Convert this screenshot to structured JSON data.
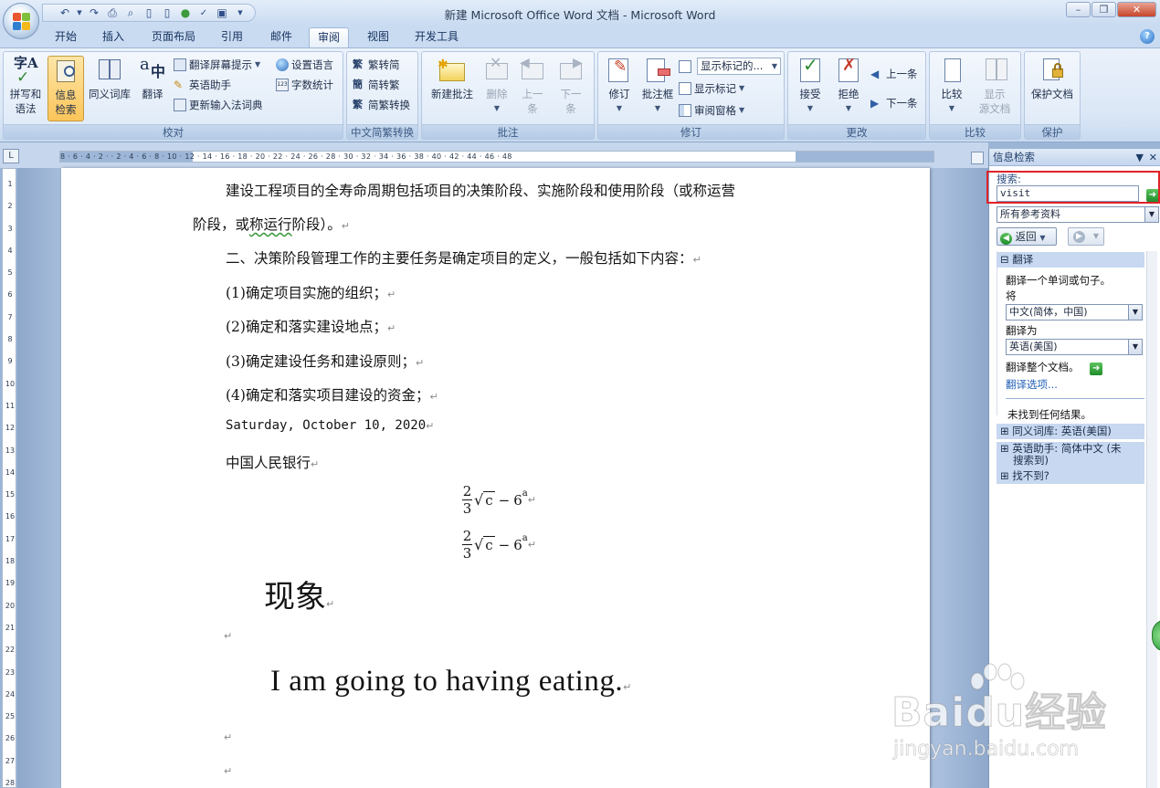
{
  "window": {
    "title": "新建 Microsoft Office Word 文档 - Microsoft Word"
  },
  "tabs": [
    "开始",
    "插入",
    "页面布局",
    "引用",
    "邮件",
    "审阅",
    "视图",
    "开发工具"
  ],
  "active_tab": "审阅",
  "ribbon": {
    "proofing": {
      "label": "校对",
      "spelling": "拼写和\n语法",
      "research": "信息\n检索",
      "thesaurus": "同义词库",
      "translate": "翻译",
      "translate_tip": "翻译屏幕提示",
      "english_assistant": "英语助手",
      "update_ime": "更新输入法词典",
      "set_language": "设置语言",
      "word_count": "字数统计"
    },
    "chinese_conversion": {
      "label": "中文简繁转换",
      "t2s": "繁转简",
      "s2t": "简转繁",
      "convert": "简繁转换"
    },
    "comments": {
      "label": "批注",
      "new": "新建批注",
      "delete": "删除",
      "prev": "上一\n条",
      "next": "下一\n条"
    },
    "tracking": {
      "label": "修订",
      "track": "修订",
      "balloons": "批注框",
      "display_combo": "显示标记的...",
      "show_markup": "显示标记",
      "review_pane": "审阅窗格"
    },
    "changes": {
      "label": "更改",
      "accept": "接受",
      "reject": "拒绝",
      "previous": "上一条",
      "next": "下一条"
    },
    "compare": {
      "label": "比较",
      "compare": "比较",
      "show_source": "显示\n源文档"
    },
    "protect": {
      "label": "保护",
      "protect_doc": "保护文档"
    }
  },
  "ruler": {
    "corner": "L",
    "h_numbers": "8 · 6 · 4 · 2 · · 2 · 4 · 6 · 8 · 10 · 12 · 14 · 16 · 18 · 20 · 22 · 24 · 26 · 28 · 30 · 32 · 34 · 36 · 38 · 40 · 42 · 44 · 46 · 48",
    "v_numbers": [
      "1",
      "2",
      "3",
      "4",
      "5",
      "6",
      "7",
      "8",
      "9",
      "10",
      "11",
      "12",
      "13",
      "14",
      "15",
      "16",
      "17",
      "18",
      "19",
      "20",
      "21",
      "22",
      "23",
      "24",
      "25",
      "26",
      "27",
      "28"
    ]
  },
  "document": {
    "p1_line1": "建设工程项目的全寿命周期包括项目的决策阶段、实施阶段和使用阶段（或称运营",
    "p1_line2_a": "阶段，或",
    "p1_line2_b": "称运行",
    "p1_line2_c": "阶段）。",
    "p2": "二、决策阶段管理工作的主要任务是确定项目的定义，一般包括如下内容：",
    "item1": "(1)确定项目实施的组织；",
    "item2": "(2)确定和落实建设地点；",
    "item3": "(3)确定建设任务和建设原则；",
    "item4": "(4)确定和落实项目建设的资金；",
    "date": "Saturday, October 10, 2020",
    "bank": "中国人民银行",
    "eq_num": "2",
    "eq_den": "3",
    "eq_rad": "c",
    "eq_minus": "−",
    "eq_base": "6",
    "eq_exp": "a",
    "big_cn": "现象",
    "big_en": "I am going to having eating.",
    "para_mark": "↵"
  },
  "pane": {
    "title": "信息检索",
    "search_label": "搜索:",
    "search_value": "visit",
    "resource_combo": "所有参考资料",
    "back_label": "返回",
    "translate_head": "翻译",
    "translate_desc": "翻译一个单词或句子。",
    "from_label": "将",
    "from_value": "中文(简体，中国)",
    "to_label": "翻译为",
    "to_value": "英语(美国)",
    "translate_doc": "翻译整个文档。",
    "translate_options": "翻译选项...",
    "no_results": "未找到任何结果。",
    "thesaurus_head": "同义词库: 英语(美国)",
    "assistant_head_1": "英语助手: 简体中文 (未",
    "assistant_head_2": "搜索到)",
    "not_found_head": "找不到?"
  },
  "watermark": {
    "brand": "Baidu经验",
    "url": "jingyan.baidu.com"
  },
  "colors": {
    "ribbon_bg": "#dbe7f6",
    "selected_button": "#fbc55a",
    "highlight_box": "#e0232a",
    "section_header": "#c7d8f0"
  }
}
